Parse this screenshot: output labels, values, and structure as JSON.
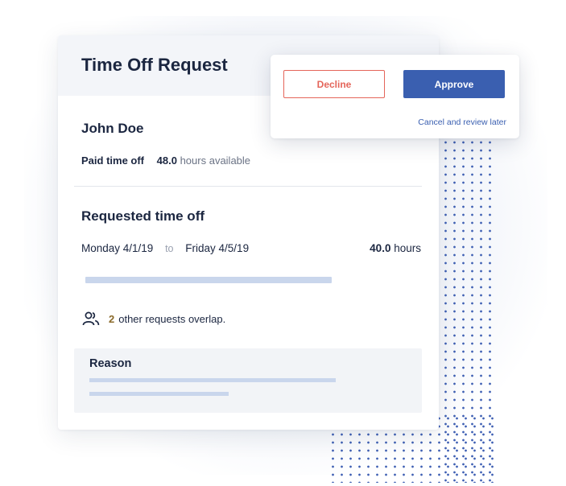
{
  "card": {
    "title": "Time Off Request",
    "employee_name": "John Doe",
    "balance": {
      "type": "Paid time off",
      "hours": "48.0",
      "unit": "hours available"
    },
    "requested": {
      "section_title": "Requested time off",
      "start": "Monday 4/1/19",
      "separator": "to",
      "end": "Friday 4/5/19",
      "hours": "40.0",
      "hours_unit": "hours"
    },
    "overlap": {
      "icon": "people-icon",
      "count": "2",
      "text": "other requests overlap."
    },
    "reason": {
      "label": "Reason"
    }
  },
  "actions": {
    "decline_label": "Decline",
    "approve_label": "Approve",
    "later_label": "Cancel and review later"
  },
  "colors": {
    "accent": "#3a5fb0",
    "decline": "#e4655a",
    "dots": "#3e5fb3",
    "placeholder_bar": "#c9d6ec"
  }
}
